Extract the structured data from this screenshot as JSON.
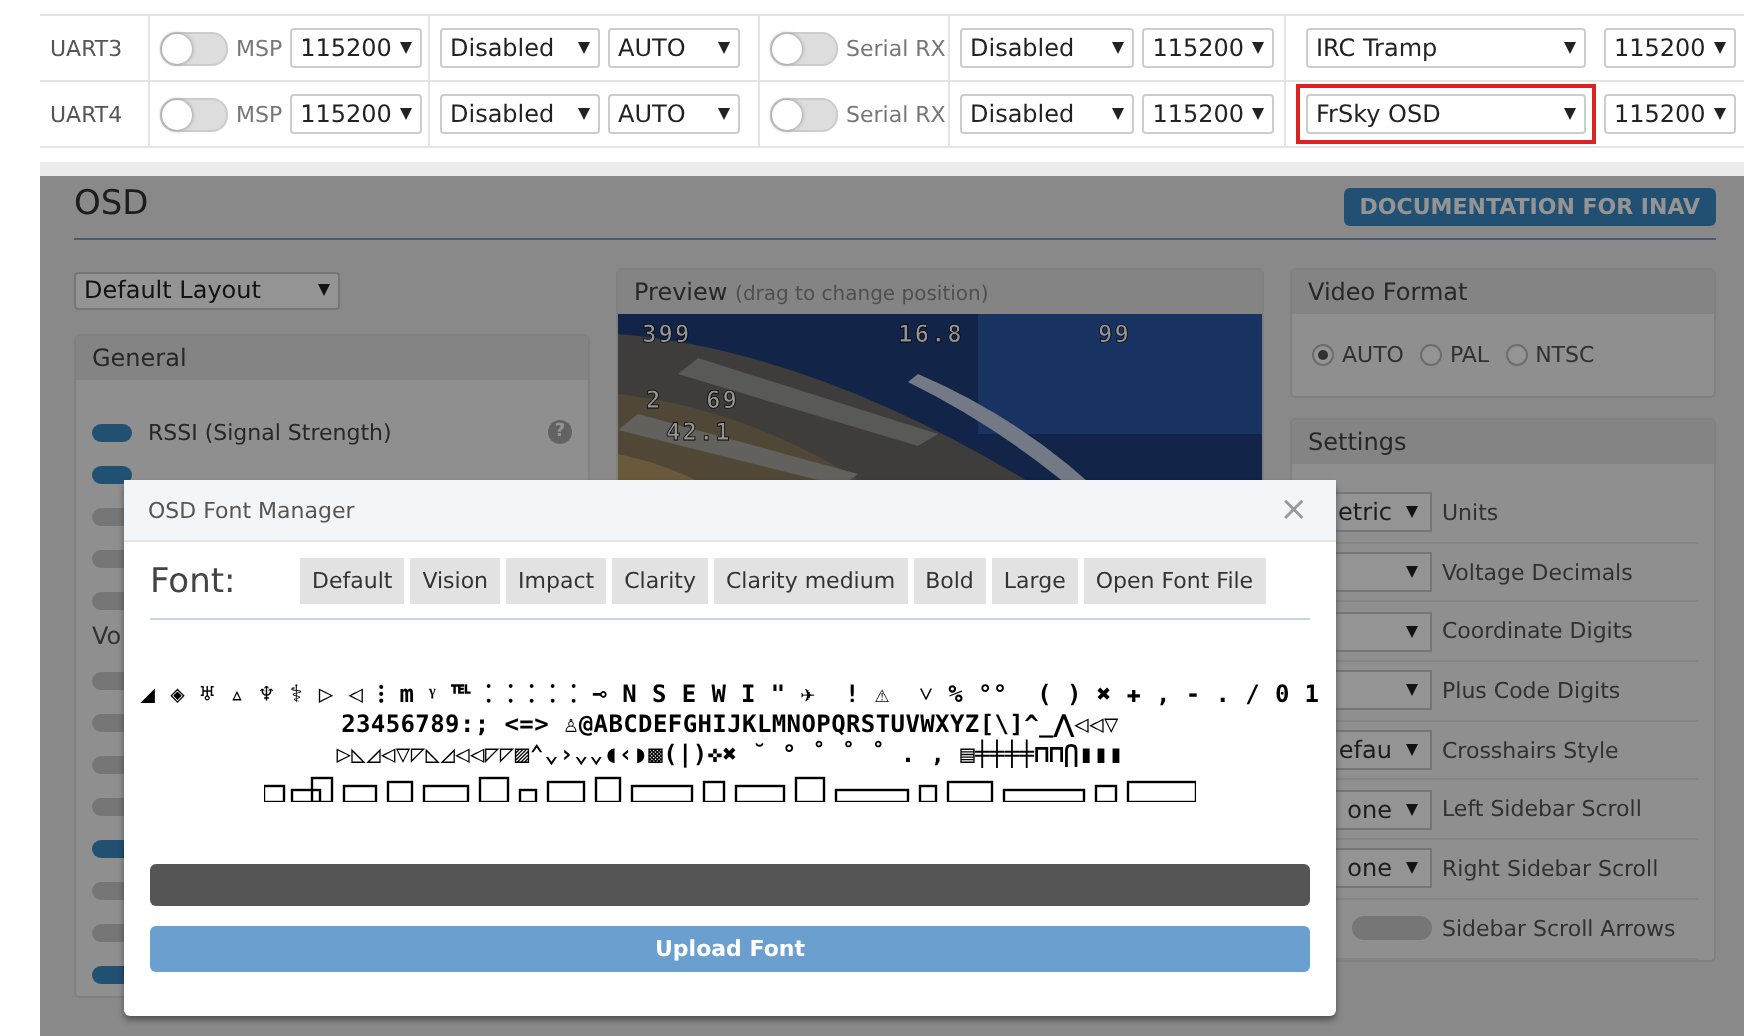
{
  "ports": [
    {
      "name": "UART3",
      "msp": {
        "label": "MSP",
        "on": false,
        "baud": "115200"
      },
      "telemetry": {
        "protocol": "Disabled",
        "baud": "AUTO"
      },
      "rx": {
        "label": "Serial RX",
        "on": false
      },
      "sensors": {
        "protocol": "Disabled",
        "baud": "115200"
      },
      "peripherals": {
        "protocol": "IRC Tramp",
        "baud": "115200",
        "highlighted": false
      }
    },
    {
      "name": "UART4",
      "msp": {
        "label": "MSP",
        "on": false,
        "baud": "115200"
      },
      "telemetry": {
        "protocol": "Disabled",
        "baud": "AUTO"
      },
      "rx": {
        "label": "Serial RX",
        "on": false
      },
      "sensors": {
        "protocol": "Disabled",
        "baud": "115200"
      },
      "peripherals": {
        "protocol": "FrSky OSD",
        "baud": "115200",
        "highlighted": true
      }
    }
  ],
  "osd": {
    "title": "OSD",
    "doc_button": "DOCUMENTATION FOR INAV",
    "layout_select": "Default Layout",
    "general": {
      "title": "General",
      "items": [
        {
          "kind": "toggle",
          "on": true,
          "label": "RSSI (Signal Strength)",
          "help": "?"
        },
        {
          "kind": "toggle",
          "on": true
        },
        {
          "kind": "toggle",
          "on": false
        },
        {
          "kind": "toggle",
          "on": false
        },
        {
          "kind": "toggle",
          "on": false
        },
        {
          "kind": "heading",
          "label": "Vo"
        },
        {
          "kind": "toggle",
          "on": false
        },
        {
          "kind": "toggle",
          "on": false
        },
        {
          "kind": "toggle",
          "on": false
        },
        {
          "kind": "toggle",
          "on": false
        },
        {
          "kind": "toggle",
          "on": true
        },
        {
          "kind": "toggle",
          "on": false
        },
        {
          "kind": "toggle",
          "on": false
        },
        {
          "kind": "toggle",
          "on": true
        }
      ]
    },
    "preview": {
      "title": "Preview",
      "hint": "(drag to change position)",
      "osd_elements": [
        {
          "text": "399",
          "kind": "altitude"
        },
        {
          "text": "16.8",
          "kind": "battery"
        },
        {
          "text": "99",
          "kind": "rssi"
        },
        {
          "text": "2",
          "kind": "sats"
        },
        {
          "text": "69",
          "kind": "speed"
        },
        {
          "text": "42.1",
          "kind": "distance"
        }
      ]
    },
    "video_format": {
      "title": "Video Format",
      "options": [
        {
          "label": "AUTO",
          "selected": true
        },
        {
          "label": "PAL",
          "selected": false
        },
        {
          "label": "NTSC",
          "selected": false
        }
      ]
    },
    "settings": {
      "title": "Settings",
      "rows": [
        {
          "kind": "select",
          "value": "etric",
          "label": "Units"
        },
        {
          "kind": "select",
          "label": "Voltage Decimals"
        },
        {
          "kind": "select",
          "label": "Coordinate Digits"
        },
        {
          "kind": "select",
          "label": "Plus Code Digits"
        },
        {
          "kind": "select",
          "value": "efau",
          "label": "Crosshairs Style"
        },
        {
          "kind": "select",
          "value": "one",
          "label": "Left Sidebar Scroll"
        },
        {
          "kind": "select",
          "value": "one",
          "label": "Right Sidebar Scroll"
        },
        {
          "kind": "toggle",
          "on": false,
          "label": "Sidebar Scroll Arrows"
        }
      ]
    }
  },
  "font_manager": {
    "title": "OSD Font Manager",
    "close": "×",
    "font_label": "Font:",
    "fonts": [
      "Default",
      "Vision",
      "Impact",
      "Clarity",
      "Clarity medium",
      "Bold",
      "Large",
      "Open Font File"
    ],
    "glyph_rows": [
      "◢ ◈ ♅ ▵ ♆ ⚕ ▷ ◁ ⁝ m ᵞ ℡ ⁚ ⁚ ⁚ ⁚ ⁚ ⊸ N S E W I \" ✈  ! ⚠  ˅ % °°  ( ) ✖ ✚ , - . / 0 1",
      "23456789:; <=> ♙@ABCDEFGHIJKLMNOPQRSTUVWXYZ[\\]^_⋀◁◁▽",
      "▷◺◿◁▽◸◺◿◁◁◸◸▨⌃⌄›⌄⌄◖‹◗▩(|)✜✖ ˘ ° ˚ ˚ ˚ . ‚ ▤╪╪╪╪⊓⊓⋂▮▮▮"
    ],
    "progress": {
      "level": 1
    },
    "upload_button": "Upload Font"
  }
}
